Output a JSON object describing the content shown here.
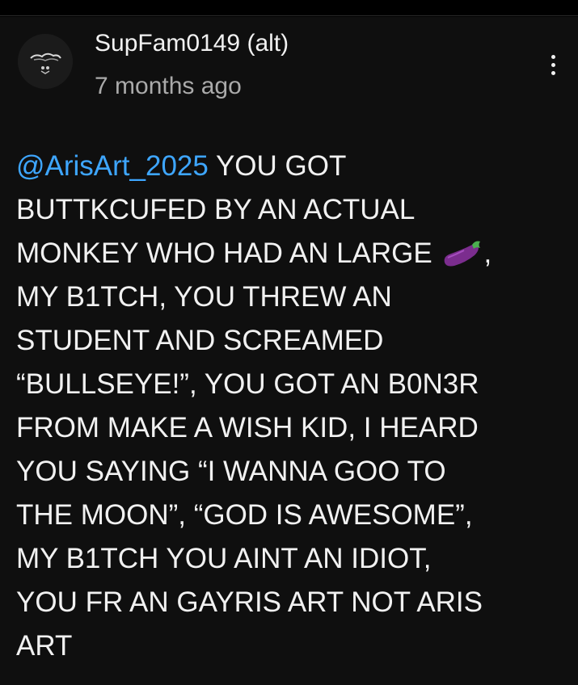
{
  "comment": {
    "author": "SupFam0149 (alt)",
    "timestamp": "7 months ago",
    "menu_icon": "more-vertical-icon",
    "avatar_icon": "avatar-icon",
    "mention": "@ArisArt_2025",
    "emoji_icon": "eggplant-icon",
    "lines": [
      " YOU GOT",
      "BUTTKCUFED BY AN ACTUAL",
      "MONKEY WHO HAD AN LARGE",
      ",",
      "MY B1TCH, YOU THREW AN",
      "STUDENT AND SCREAMED",
      "“BULLSEYE!”, YOU GOT AN B0N3R",
      "FROM MAKE A WISH KID, I HEARD",
      "YOU SAYING “I WANNA GOO TO",
      "THE MOON”, “GOD IS AWESOME”,",
      "MY B1TCH YOU AINT AN IDIOT,",
      "YOU FR AN GAYRIS ART NOT ARIS",
      "ART"
    ]
  },
  "colors": {
    "background": "#0f0f0f",
    "text": "#f1f1f1",
    "secondary_text": "#aaaaaa",
    "mention": "#3ea6ff",
    "emoji_purple": "#7b2d8e",
    "emoji_green": "#4caf50"
  }
}
